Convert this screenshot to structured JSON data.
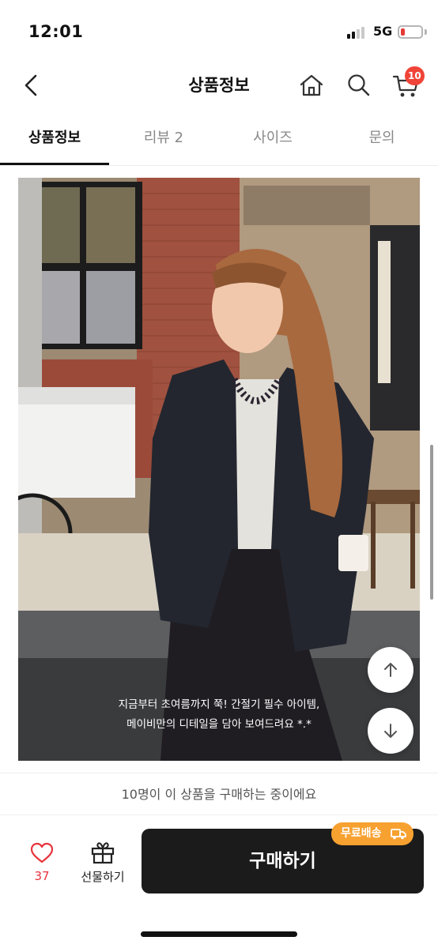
{
  "status_bar": {
    "time": "12:01",
    "network": "5G",
    "battery_level": 0.12,
    "battery_color": "#e53935"
  },
  "header": {
    "title": "상품정보",
    "back_icon": "chevron-left-icon",
    "home_icon": "home-icon",
    "search_icon": "search-icon",
    "cart_icon": "cart-icon",
    "cart_count": "10",
    "badge_color": "#f04438"
  },
  "tabs": [
    {
      "label": "상품정보",
      "active": true
    },
    {
      "label": "리뷰 2",
      "active": false
    },
    {
      "label": "사이즈",
      "active": false
    },
    {
      "label": "문의",
      "active": false
    }
  ],
  "product_image": {
    "caption_line1": "지금부터 초여름까지 쭉! 간절기 필수 아이템,",
    "caption_line2": "메이비만의 디테일을 담아 보여드려요 *.*",
    "scroll_up_icon": "arrow-up-icon",
    "scroll_down_icon": "arrow-down-icon"
  },
  "buyers_notice": "10명이 이 상품을 구매하는 중이에요",
  "bottom_bar": {
    "like_icon": "heart-icon",
    "like_count": "37",
    "like_color": "#e8343d",
    "gift_icon": "gift-icon",
    "gift_label": "선물하기",
    "buy_label": "구매하기",
    "free_shipping_label": "무료배송",
    "free_shipping_icon": "truck-icon",
    "free_shipping_color": "#f7a130"
  }
}
